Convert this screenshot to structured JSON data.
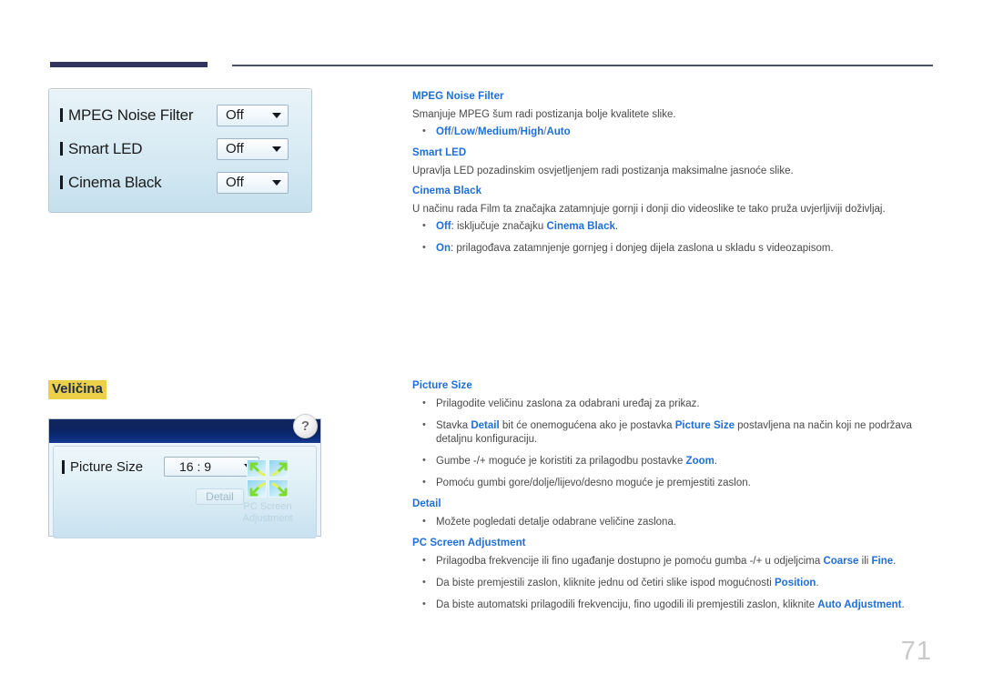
{
  "page": {
    "number": "71"
  },
  "section": {
    "heading": "Veličina"
  },
  "osd_picture_options": {
    "rows": [
      {
        "label": "MPEG Noise Filter",
        "value": "Off"
      },
      {
        "label": "Smart LED",
        "value": "Off"
      },
      {
        "label": "Cinema Black",
        "value": "Off"
      }
    ]
  },
  "osd_picture_size": {
    "help_badge": "?",
    "label": "Picture Size",
    "value": "16 : 9",
    "detail_button": "Detail",
    "pc_screen_adjustment": "PC Screen Adjustment"
  },
  "doc_top": {
    "mpeg_noise_filter": {
      "heading": "MPEG Noise Filter",
      "body": "Smanjuje MPEG šum radi postizanja bolje kvalitete slike.",
      "options": [
        "Off",
        "Low",
        "Medium",
        "High",
        "Auto"
      ],
      "separator": "/"
    },
    "smart_led": {
      "heading": "Smart LED",
      "body": "Upravlja LED pozadinskim osvjetljenjem radi postizanja maksimalne jasnoće slike."
    },
    "cinema_black": {
      "heading": "Cinema Black",
      "body": "U načinu rada Film ta značajka zatamnjuje gornji i donji dio videoslike te tako pruža uvjerljiviji doživljaj.",
      "bullets": [
        {
          "lead": "Off",
          "text_1": ": isključuje značajku ",
          "emph": "Cinema Black",
          "text_2": "."
        },
        {
          "lead": "On",
          "text_1": ": prilagođava zatamnjenje gornjeg i donjeg dijela zaslona u skladu s videozapisom.",
          "emph": "",
          "text_2": ""
        }
      ]
    }
  },
  "doc_bottom": {
    "picture_size": {
      "heading": "Picture Size",
      "bullets": [
        {
          "part_1": "Prilagodite veličinu zaslona za odabrani uređaj za prikaz.",
          "emph_1": "",
          "part_2": "",
          "emph_2": "",
          "part_3": ""
        },
        {
          "part_1": "Stavka ",
          "emph_1": "Detail",
          "part_2": " bit će onemogućena ako je postavka ",
          "emph_2": "Picture Size",
          "part_3": " postavljena na način koji ne podržava detaljnu konfiguraciju."
        },
        {
          "part_1": "Gumbe -/+ moguće je koristiti za prilagodbu postavke ",
          "emph_1": "Zoom",
          "part_2": ".",
          "emph_2": "",
          "part_3": ""
        },
        {
          "part_1": "Pomoću gumbi gore/dolje/lijevo/desno moguće je premjestiti zaslon.",
          "emph_1": "",
          "part_2": "",
          "emph_2": "",
          "part_3": ""
        }
      ]
    },
    "detail": {
      "heading": "Detail",
      "bullets": [
        {
          "part_1": "Možete pogledati detalje odabrane veličine zaslona.",
          "emph_1": "",
          "part_2": "",
          "emph_2": "",
          "part_3": ""
        }
      ]
    },
    "pc_screen_adjustment": {
      "heading": "PC Screen Adjustment",
      "bullets": [
        {
          "part_1": "Prilagodba frekvencije ili fino ugađanje dostupno je pomoću gumba -/+ u odjeljcima ",
          "emph_1": "Coarse",
          "part_2": " ili ",
          "emph_2": "Fine",
          "part_3": "."
        },
        {
          "part_1": "Da biste premjestili zaslon, kliknite jednu od četiri slike ispod mogućnosti ",
          "emph_1": "Position",
          "part_2": ".",
          "emph_2": "",
          "part_3": ""
        },
        {
          "part_1": "Da biste automatski prilagodili frekvenciju, fino ugodili ili premjestili zaslon, kliknite ",
          "emph_1": "Auto Adjustment",
          "part_2": ".",
          "emph_2": "",
          "part_3": ""
        }
      ]
    }
  },
  "colors": {
    "accent_blue": "#1f6fd8",
    "rule_navy": "#31355e",
    "highlight_gold": "#ecd04a",
    "body_text": "#4a4a4a",
    "page_number": "#c9c9c9"
  }
}
